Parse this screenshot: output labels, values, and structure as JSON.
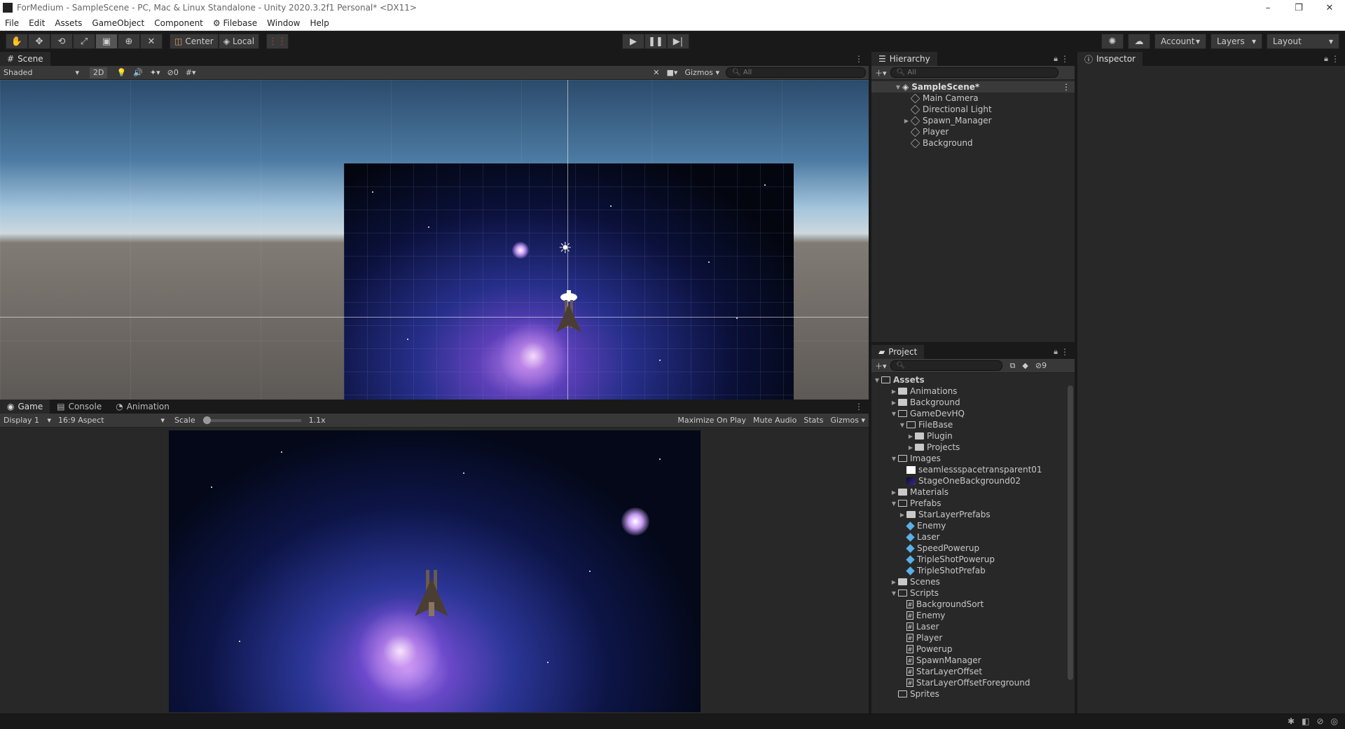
{
  "window": {
    "title": "ForMedium - SampleScene - PC, Mac & Linux Standalone - Unity 2020.3.2f1 Personal* <DX11>",
    "controls": [
      "–",
      "❐",
      "✕"
    ]
  },
  "menu": [
    "File",
    "Edit",
    "Assets",
    "GameObject",
    "Component",
    "Filebase",
    "Window",
    "Help"
  ],
  "toolbar": {
    "pivot": "Center",
    "space": "Local",
    "account": "Account",
    "layers": "Layers",
    "layout": "Layout"
  },
  "scene": {
    "tab": "Scene",
    "shading": "Shaded",
    "mode_2d": "2D",
    "hidden_count": "0",
    "gizmos": "Gizmos",
    "search_placeholder": "All"
  },
  "game": {
    "tabs": [
      "Game",
      "Console",
      "Animation"
    ],
    "display": "Display 1",
    "aspect": "16:9 Aspect",
    "scale_label": "Scale",
    "scale_value": "1.1x",
    "maximize": "Maximize On Play",
    "mute": "Mute Audio",
    "stats": "Stats",
    "gizmos": "Gizmos"
  },
  "hierarchy": {
    "tab": "Hierarchy",
    "search_placeholder": "All",
    "scene_name": "SampleScene*",
    "items": [
      {
        "label": "Main Camera",
        "expandable": false
      },
      {
        "label": "Directional Light",
        "expandable": false
      },
      {
        "label": "Spawn_Manager",
        "expandable": true
      },
      {
        "label": "Player",
        "expandable": false
      },
      {
        "label": "Background",
        "expandable": false
      }
    ]
  },
  "inspector": {
    "tab": "Inspector"
  },
  "project": {
    "tab": "Project",
    "hidden_count": "9",
    "root": "Assets",
    "tree": [
      {
        "label": "Animations",
        "depth": 1,
        "type": "folder",
        "state": "collapsed"
      },
      {
        "label": "Background",
        "depth": 1,
        "type": "folder",
        "state": "collapsed"
      },
      {
        "label": "GameDevHQ",
        "depth": 1,
        "type": "folder",
        "state": "expanded"
      },
      {
        "label": "FileBase",
        "depth": 2,
        "type": "folder",
        "state": "expanded"
      },
      {
        "label": "Plugin",
        "depth": 3,
        "type": "folder",
        "state": "collapsed"
      },
      {
        "label": "Projects",
        "depth": 3,
        "type": "folder",
        "state": "collapsed"
      },
      {
        "label": "Images",
        "depth": 1,
        "type": "folder",
        "state": "expanded"
      },
      {
        "label": "seamlessspacetransparent01",
        "depth": 2,
        "type": "texture-white",
        "state": "none"
      },
      {
        "label": "StageOneBackground02",
        "depth": 2,
        "type": "texture-dark",
        "state": "none"
      },
      {
        "label": "Materials",
        "depth": 1,
        "type": "folder",
        "state": "collapsed"
      },
      {
        "label": "Prefabs",
        "depth": 1,
        "type": "folder",
        "state": "expanded"
      },
      {
        "label": "StarLayerPrefabs",
        "depth": 2,
        "type": "folder",
        "state": "collapsed"
      },
      {
        "label": "Enemy",
        "depth": 2,
        "type": "prefab",
        "state": "none"
      },
      {
        "label": "Laser",
        "depth": 2,
        "type": "prefab",
        "state": "none"
      },
      {
        "label": "SpeedPowerup",
        "depth": 2,
        "type": "prefab",
        "state": "none"
      },
      {
        "label": "TripleShotPowerup",
        "depth": 2,
        "type": "prefab",
        "state": "none"
      },
      {
        "label": "TripleShotPrefab",
        "depth": 2,
        "type": "prefab",
        "state": "none"
      },
      {
        "label": "Scenes",
        "depth": 1,
        "type": "folder",
        "state": "collapsed"
      },
      {
        "label": "Scripts",
        "depth": 1,
        "type": "folder",
        "state": "expanded"
      },
      {
        "label": "BackgroundSort",
        "depth": 2,
        "type": "script",
        "state": "none"
      },
      {
        "label": "Enemy",
        "depth": 2,
        "type": "script",
        "state": "none"
      },
      {
        "label": "Laser",
        "depth": 2,
        "type": "script",
        "state": "none"
      },
      {
        "label": "Player",
        "depth": 2,
        "type": "script",
        "state": "none"
      },
      {
        "label": "Powerup",
        "depth": 2,
        "type": "script",
        "state": "none"
      },
      {
        "label": "SpawnManager",
        "depth": 2,
        "type": "script",
        "state": "none"
      },
      {
        "label": "StarLayerOffset",
        "depth": 2,
        "type": "script",
        "state": "none"
      },
      {
        "label": "StarLayerOffsetForeground",
        "depth": 2,
        "type": "script",
        "state": "none"
      },
      {
        "label": "Sprites",
        "depth": 1,
        "type": "folder-open",
        "state": "none"
      }
    ]
  }
}
